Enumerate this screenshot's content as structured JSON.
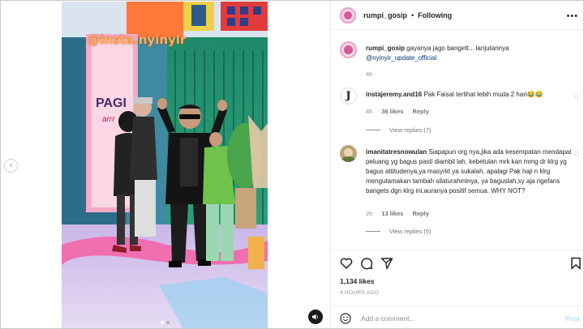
{
  "media": {
    "watermark": "@insta.nyinyir",
    "sign_text": "PAGI",
    "sign_subtext": "arrr"
  },
  "header": {
    "username": "rumpi_gosip",
    "separator": "•",
    "follow_label": "Following",
    "more_label": "•••"
  },
  "caption": {
    "username": "rumpi_gosip",
    "text": "gayanya jago bangett... lanjutannya",
    "mention": "@nyinyir_update_official",
    "time": "4h"
  },
  "comments": [
    {
      "username": "instajeremy.and16",
      "text": "Pak Faisal terlihat lebih muda 2 hari😂😂",
      "time": "4h",
      "likes": "36 likes",
      "reply_label": "Reply",
      "view_replies": "View replies (7)"
    },
    {
      "username": "imanitatresnowulan",
      "text": "Siapapun org nya,jika ada kesempatan mendapat peluang yg bagus pasti diambil lah, kebetulan mrk kan mmg dr klrg yg bagus attitudenya,ya masyrkt ya sukalah, apalagi Pak haji n klrg mengutamakan tambah silaturahminya, ya baguslah,sy aja ngefans bangets dgn klrg ini,auranya positif semua. WHY NOT?",
      "time": "2h",
      "likes": "13 likes",
      "reply_label": "Reply",
      "view_replies": "View replies (5)"
    }
  ],
  "actions": {
    "likes": "1,134 likes",
    "time_ago": "4 HOURS AGO"
  },
  "add_comment": {
    "placeholder": "Add a comment...",
    "post_label": "Post"
  },
  "colors": {
    "watermark": "#ffb060",
    "link": "#00376b",
    "post_disabled": "#b2dffc"
  }
}
